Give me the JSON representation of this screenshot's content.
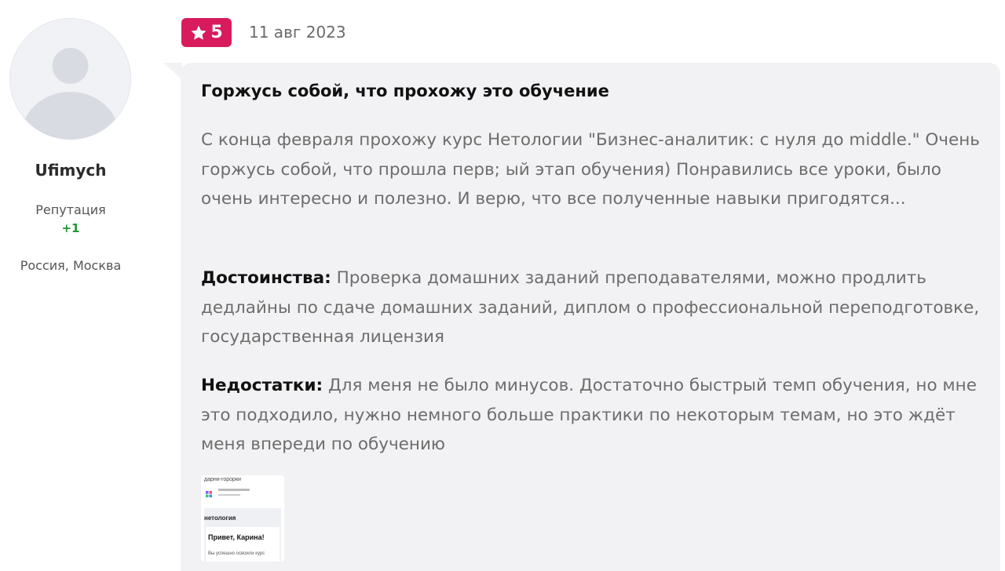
{
  "user": {
    "username": "Ufimych",
    "reputation_label": "Репутация",
    "reputation_value": "+1",
    "location": "Россия, Москва",
    "avatar_icon": "user-silhouette-icon"
  },
  "review": {
    "rating": "5",
    "rating_icon": "star-icon",
    "rating_color": "#d81b5c",
    "date": "11 авг 2023",
    "title": "Горжусь собой, что прохожу это обучение",
    "body": "С конца февраля прохожу курс Нетологии \"Бизнес-аналитик: с нуля до middle.\" Очень горжусь собой, что прошла перв; ый этап обучения) Понравились все уроки, было очень интересно и полезно. И верю, что все полученные навыки пригодятся...",
    "pros_label": "Достоинства:",
    "pros_text": " Проверка домашних заданий преподавателями, можно продлить дедлайны по сдаче домашних заданий, диплом о профессиональной переподготовке, государственная лицензия",
    "cons_label": "Недостатки:",
    "cons_text": " Для меня не было минусов. Достаточно быстрый темп обучения, но мне это подходило, нужно немного больше практики по некоторым темам, но это ждёт меня впереди по обучению"
  },
  "attachment": {
    "header_text": "дарни-горорки",
    "logo_text": "нетология",
    "greeting": "Привет, Карина!",
    "note": "Вы успешно освоили курс"
  }
}
